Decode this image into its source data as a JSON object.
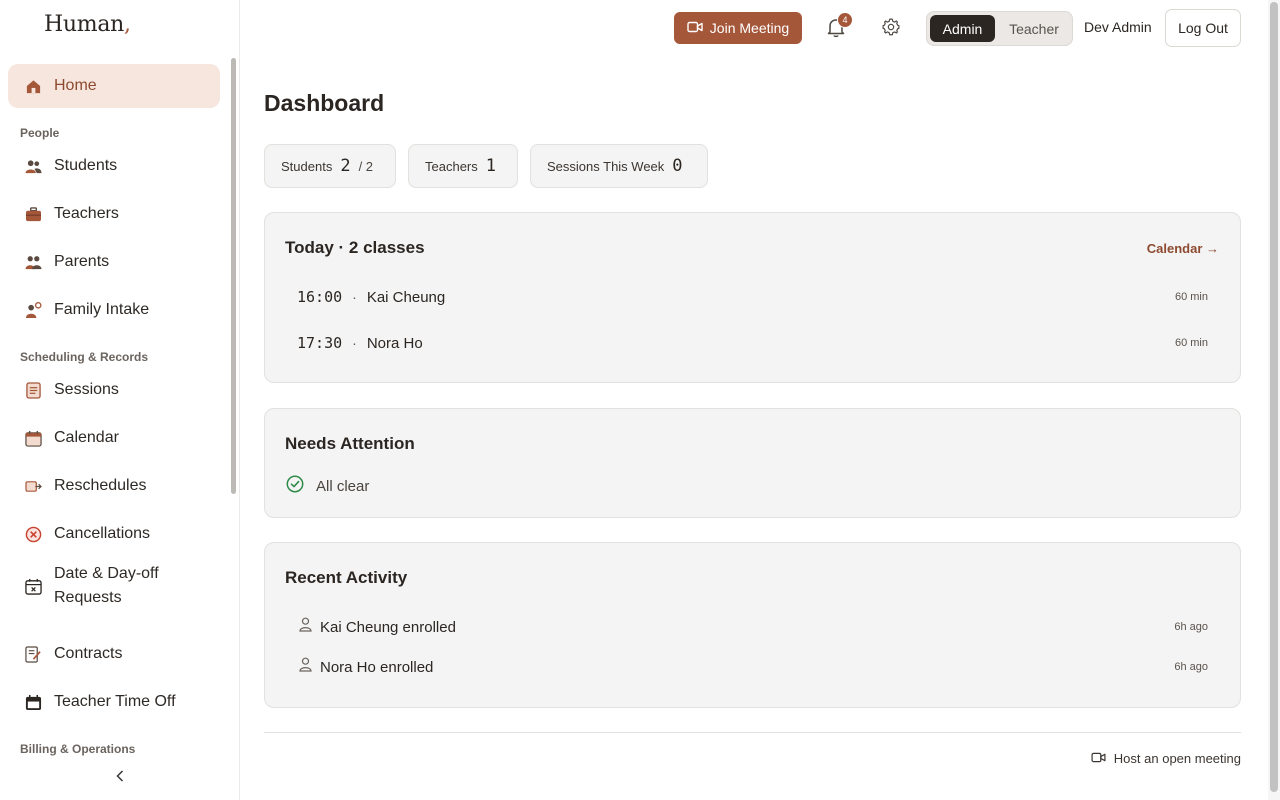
{
  "brand": {
    "name": "Human",
    "punct": ","
  },
  "sidebar": {
    "home": "Home",
    "sections": {
      "people": "People",
      "scheduling": "Scheduling & Records",
      "billing": "Billing & Operations"
    },
    "people_items": [
      "Students",
      "Teachers",
      "Parents",
      "Family Intake"
    ],
    "scheduling_items": [
      "Sessions",
      "Calendar",
      "Reschedules",
      "Cancellations",
      "Date & Day-off Requests",
      "Contracts",
      "Teacher Time Off"
    ]
  },
  "header": {
    "join_meeting": "Join Meeting",
    "notification_count": "4",
    "roles": {
      "admin": "Admin",
      "teacher": "Teacher"
    },
    "user": "Dev Admin",
    "logout": "Log Out"
  },
  "dashboard": {
    "title": "Dashboard",
    "stats": {
      "students": {
        "label": "Students",
        "value": "2",
        "total": "/ 2"
      },
      "teachers": {
        "label": "Teachers",
        "value": "1"
      },
      "sessions": {
        "label": "Sessions This Week",
        "value": "0"
      }
    },
    "today": {
      "title": "Today · 2 classes",
      "calendar_link": "Calendar →",
      "classes": [
        {
          "time": "16:00",
          "sep": "·",
          "name": "Kai Cheung",
          "duration": "60 min"
        },
        {
          "time": "17:30",
          "sep": "·",
          "name": "Nora Ho",
          "duration": "60 min"
        }
      ]
    },
    "attention": {
      "title": "Needs Attention",
      "status": "All clear"
    },
    "activity": {
      "title": "Recent Activity",
      "items": [
        {
          "text": "Kai Cheung enrolled",
          "time": "6h ago"
        },
        {
          "text": "Nora Ho enrolled",
          "time": "6h ago"
        }
      ]
    },
    "host_meeting": "Host an open meeting"
  },
  "colors": {
    "accent": "#a5573a",
    "active_bg": "#f6e6dd",
    "dark": "#2b2622",
    "success": "#2e8b4a",
    "danger": "#c8412f"
  }
}
